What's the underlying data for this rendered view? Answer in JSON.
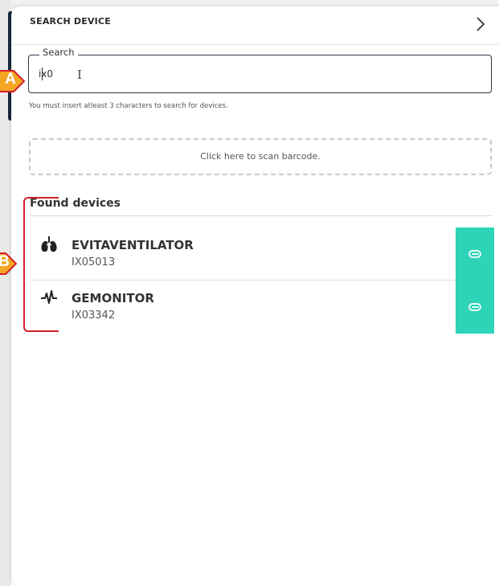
{
  "header": {
    "title": "SEARCH DEVICE",
    "chevron_icon": "chevron-right-icon"
  },
  "search": {
    "legend": "Search",
    "value": "ix0",
    "hint": "You must insert atleast 3 characters to search for devices."
  },
  "scan": {
    "label": "Click here to scan barcode."
  },
  "found": {
    "title": "Found devices",
    "devices": [
      {
        "name": "EVITAVENTILATOR",
        "id": "IX05013",
        "icon": "lungs-icon"
      },
      {
        "name": "GEMONITOR",
        "id": "IX03342",
        "icon": "heartbeat-icon"
      }
    ],
    "action_icon": "paperclip-icon"
  },
  "annotations": {
    "a": "A",
    "b": "B"
  },
  "colors": {
    "accent": "#2dd4b8",
    "callout_fill": "#f5a623",
    "callout_border": "#d21f2b",
    "nav_bar": "#17293a"
  }
}
